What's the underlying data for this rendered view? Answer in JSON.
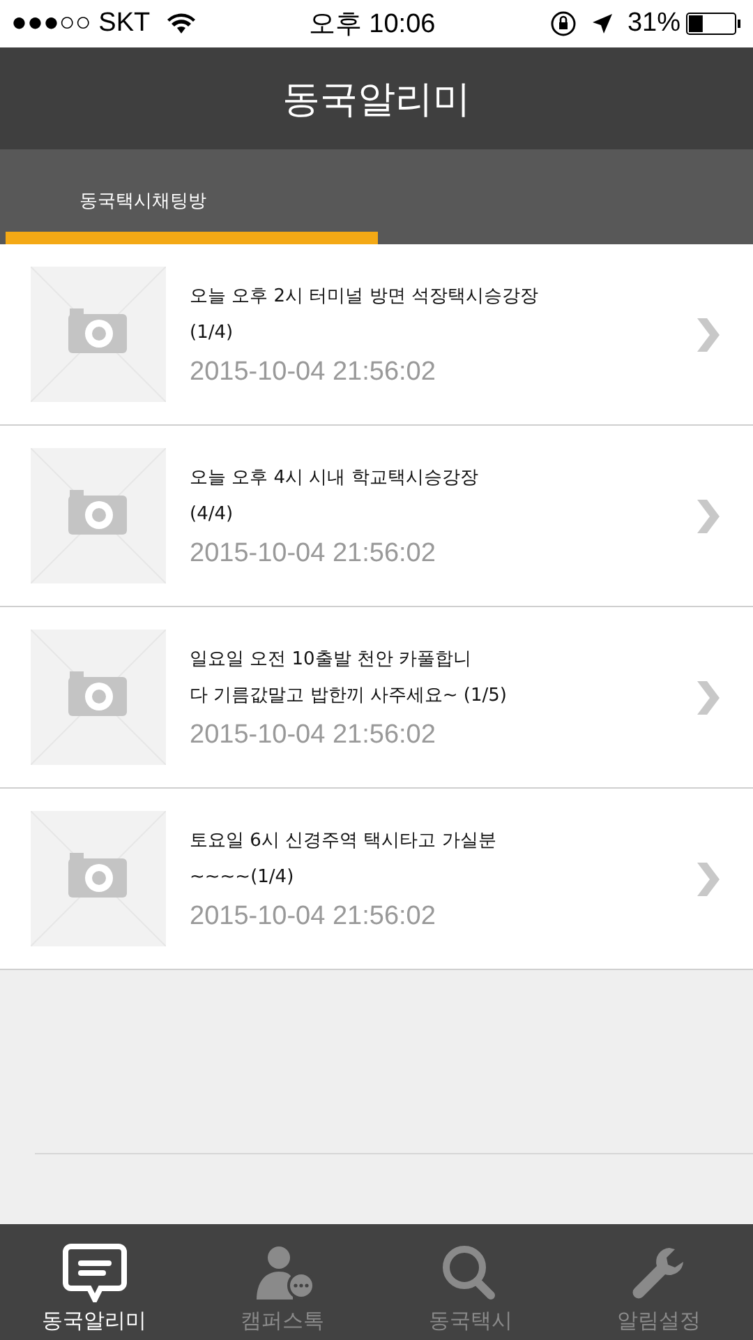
{
  "status_bar": {
    "carrier": "●●●○○ SKT",
    "time": "오후 10:06",
    "battery": "31%"
  },
  "header": {
    "title": "동국알리미"
  },
  "tabs": [
    {
      "label": "동국택시채팅방",
      "selected": true
    }
  ],
  "posts": [
    {
      "lines": [
        "오늘 오후 2시 터미널 방면 석장택시승강장",
        "(1/4)"
      ],
      "date": "2015-10-04 21:56:02"
    },
    {
      "lines": [
        "오늘 오후 4시 시내 학교택시승강장",
        "(4/4)"
      ],
      "date": "2015-10-04 21:56:02"
    },
    {
      "lines": [
        "일요일 오전 10출발 천안 카풀합니",
        "다 기름값말고 밥한끼 사주세요~  (1/5)"
      ],
      "date": "2015-10-04 21:56:02"
    },
    {
      "lines": [
        "토요일 6시 신경주역 택시타고 가실분",
        "~~~~(1/4)"
      ],
      "date": "2015-10-04 21:56:02"
    }
  ],
  "nav": [
    {
      "label": "동국알리미",
      "kind": "chat",
      "selected": true
    },
    {
      "label": "캠퍼스톡",
      "kind": "person",
      "selected": false
    },
    {
      "label": "동국택시",
      "kind": "search",
      "selected": false
    },
    {
      "label": "알림설정",
      "kind": "wrench",
      "selected": false
    }
  ]
}
